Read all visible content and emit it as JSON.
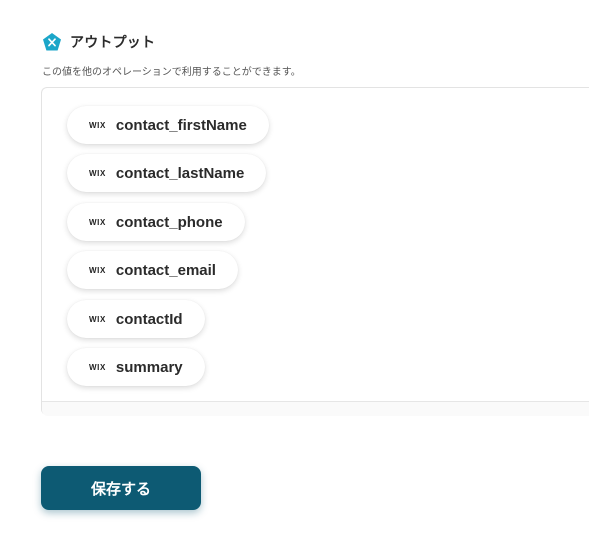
{
  "section": {
    "title": "アウトプット",
    "description": "この値を他のオペレーションで利用することができます。",
    "icon": "pentagon-x-icon",
    "icon_color": "#1ba6c9"
  },
  "outputs": [
    {
      "source_icon": "WIX",
      "label": "contact_firstName"
    },
    {
      "source_icon": "WIX",
      "label": "contact_lastName"
    },
    {
      "source_icon": "WIX",
      "label": "contact_phone"
    },
    {
      "source_icon": "WIX",
      "label": "contact_email"
    },
    {
      "source_icon": "WIX",
      "label": "contactId"
    },
    {
      "source_icon": "WIX",
      "label": "summary"
    }
  ],
  "save_button": {
    "label": "保存する",
    "color": "#0d5a73"
  }
}
